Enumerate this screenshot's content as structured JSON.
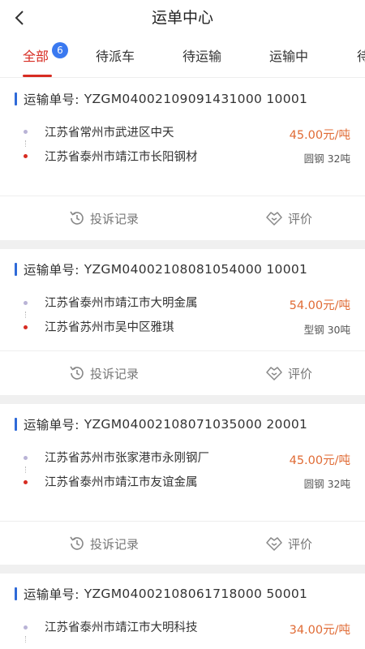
{
  "header": {
    "title": "运单中心"
  },
  "icons": {
    "back": "chevron-left-icon",
    "complaint": "clock-back-icon",
    "rate": "handshake-icon"
  },
  "colors": {
    "accent": "#d72c22",
    "badge": "#3a79f0",
    "price": "#e06b35",
    "order_bar": "#2f6ad8"
  },
  "tabs": [
    {
      "label": "全部",
      "badge": "6"
    },
    {
      "label": "待派车"
    },
    {
      "label": "待运输"
    },
    {
      "label": "运输中"
    },
    {
      "label": "待"
    }
  ],
  "orders": [
    {
      "label": "运输单号:",
      "number": "YZGM04002109091431000 10001",
      "from": "江苏省常州市武进区中天",
      "to": "江苏省泰州市靖江市长阳钢材",
      "price": "45.00元/吨",
      "spec": "圆钢  32吨",
      "complaint": "投诉记录",
      "rate": "评价"
    },
    {
      "label": "运输单号:",
      "number": "YZGM04002108081054000 10001",
      "from": "江苏省泰州市靖江市大明金属",
      "to": "江苏省苏州市吴中区雅琪",
      "price": "54.00元/吨",
      "spec": "型钢  30吨",
      "complaint": "投诉记录",
      "rate": "评价"
    },
    {
      "label": "运输单号:",
      "number": "YZGM04002108071035000 20001",
      "from": "江苏省苏州市张家港市永刚钢厂",
      "to": "江苏省泰州市靖江市友谊金属",
      "price": "45.00元/吨",
      "spec": "圆钢  32吨",
      "complaint": "投诉记录",
      "rate": "评价"
    },
    {
      "label": "运输单号:",
      "number": "YZGM04002108061718000 50001",
      "from": "江苏省泰州市靖江市大明科技",
      "price": "34.00元/吨"
    }
  ]
}
